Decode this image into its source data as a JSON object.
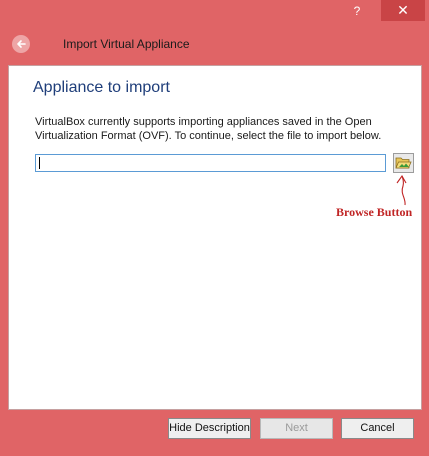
{
  "titlebar": {
    "help_label": "?",
    "close_label": "✕"
  },
  "dialog": {
    "title": "Import Virtual Appliance"
  },
  "page": {
    "heading": "Appliance to import",
    "description": "VirtualBox currently supports importing appliances saved in the Open Virtualization Format (OVF). To continue, select the file to import below.",
    "file_input": {
      "value": "",
      "placeholder": ""
    }
  },
  "annotation": {
    "label": "Browse Button",
    "color": "#c02525"
  },
  "footer": {
    "hide_description_label": "Hide Description",
    "next_label": "Next",
    "cancel_label": "Cancel"
  },
  "colors": {
    "window_frame": "#e06466",
    "close_button": "#c94446",
    "heading": "#1f3e7a"
  }
}
